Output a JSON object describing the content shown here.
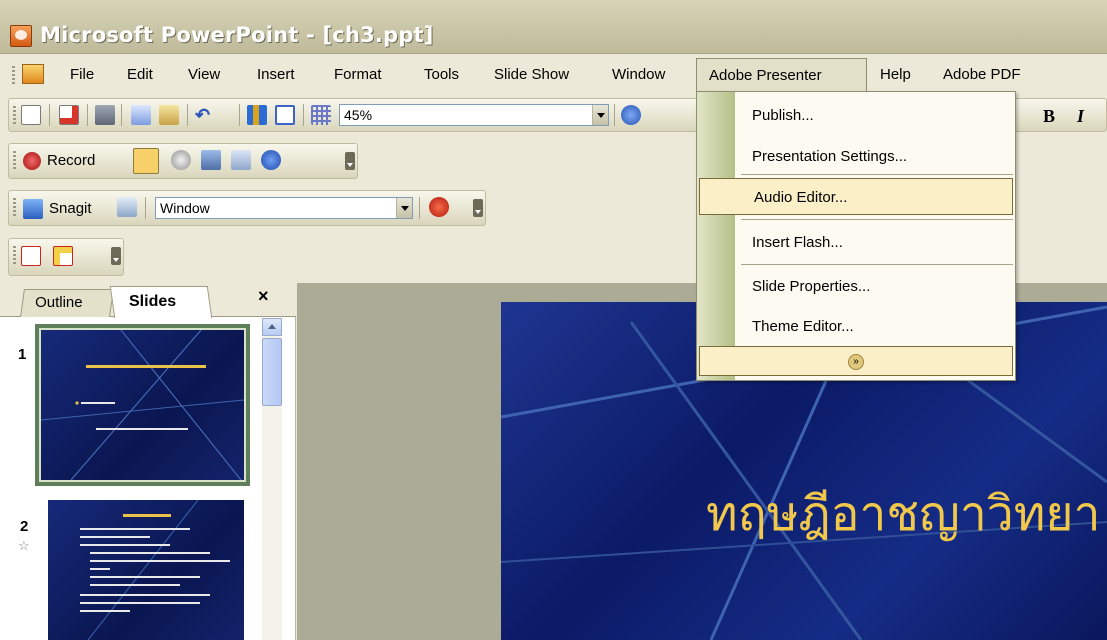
{
  "window": {
    "title": "Microsoft PowerPoint - [ch3.ppt]"
  },
  "menubar": {
    "items": [
      {
        "label": "File"
      },
      {
        "label": "Edit"
      },
      {
        "label": "View"
      },
      {
        "label": "Insert"
      },
      {
        "label": "Format"
      },
      {
        "label": "Tools"
      },
      {
        "label": "Slide Show"
      },
      {
        "label": "Window"
      },
      {
        "label": "Adobe Presenter"
      },
      {
        "label": "Help"
      },
      {
        "label": "Adobe PDF"
      }
    ]
  },
  "toolbar_standard": {
    "zoom": "45%"
  },
  "toolbar_record": {
    "record_label": "Record"
  },
  "toolbar_snagit": {
    "snagit_label": "Snagit",
    "capture_mode": "Window"
  },
  "dropdown": {
    "items": [
      {
        "label": "Publish..."
      },
      {
        "label": "Presentation Settings..."
      },
      {
        "label": "Audio Editor..."
      },
      {
        "label": "Insert Flash..."
      },
      {
        "label": "Slide Properties..."
      },
      {
        "label": "Theme Editor..."
      }
    ]
  },
  "left_pane": {
    "tabs": [
      {
        "label": "Outline"
      },
      {
        "label": "Slides"
      }
    ],
    "close_label": "×",
    "slides": [
      {
        "number": "1"
      },
      {
        "number": "2"
      }
    ]
  },
  "main_slide": {
    "title": "ทฤษฎีอาชญาวิทยา"
  },
  "colors": {
    "slide_bg": "#0B1A66",
    "slide_title": "#F2C84B",
    "menu_highlight": "#FAEFC7"
  }
}
